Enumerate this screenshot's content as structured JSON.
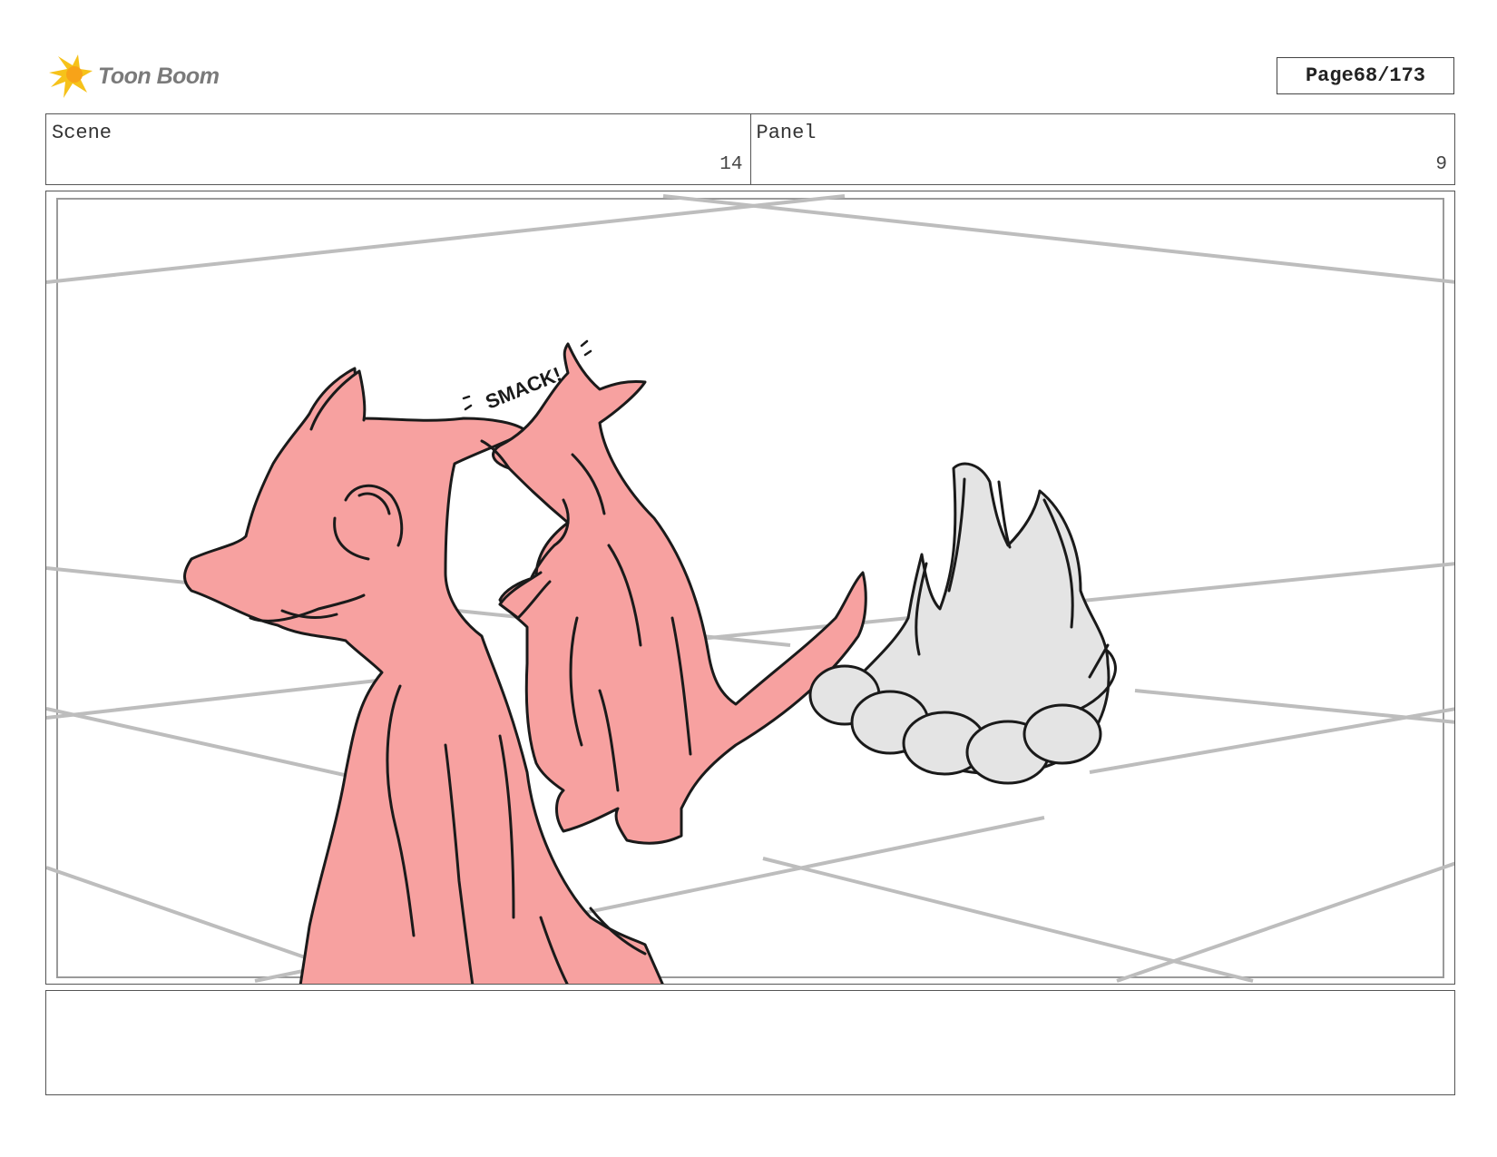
{
  "header": {
    "logo_text": "Toon Boom",
    "page_label": "Page",
    "page_value": "68/173"
  },
  "info": {
    "scene_label": "Scene",
    "scene_value": "14",
    "panel_label": "Panel",
    "panel_value": "9"
  },
  "artwork": {
    "sfx_text": "SMACK!",
    "colors": {
      "character_fill": "#f7a1a0",
      "fire_fill": "#e4e4e4",
      "guide_lines": "#bdbdbd",
      "ink": "#1a1a1a"
    }
  },
  "caption": {
    "text": ""
  }
}
